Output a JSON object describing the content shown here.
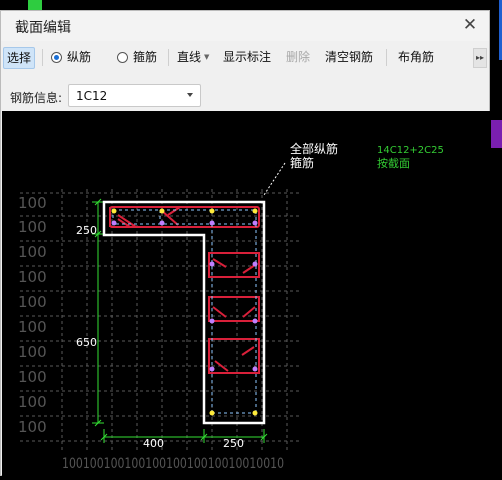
{
  "window": {
    "title": "截面编辑",
    "close_icon": "close-icon"
  },
  "toolbar": {
    "select": "选择",
    "longitudinal": "纵筋",
    "stirrup": "箍筋",
    "line": "直线",
    "show_annotation": "显示标注",
    "delete": "删除",
    "clear": "清空钢筋",
    "corner": "布角筋"
  },
  "rebar_info": {
    "label": "钢筋信息:",
    "value": "1C12"
  },
  "drawing": {
    "legend_all_long": "全部纵筋",
    "legend_stirrup": "箍筋",
    "spec_long": "14C12+2C25",
    "spec_section": "按截面",
    "dim_250_top": "250",
    "dim_650": "650",
    "dim_400": "400",
    "dim_250_bottom": "250",
    "grid_label": "100",
    "bottom_labels": "10010010010010010010010010010010",
    "colors": {
      "concrete": "#ffffff",
      "rebar": "#d9203a",
      "dim": "#33e033",
      "spec": "#33cc33",
      "grid": "#5a5a5a"
    }
  }
}
